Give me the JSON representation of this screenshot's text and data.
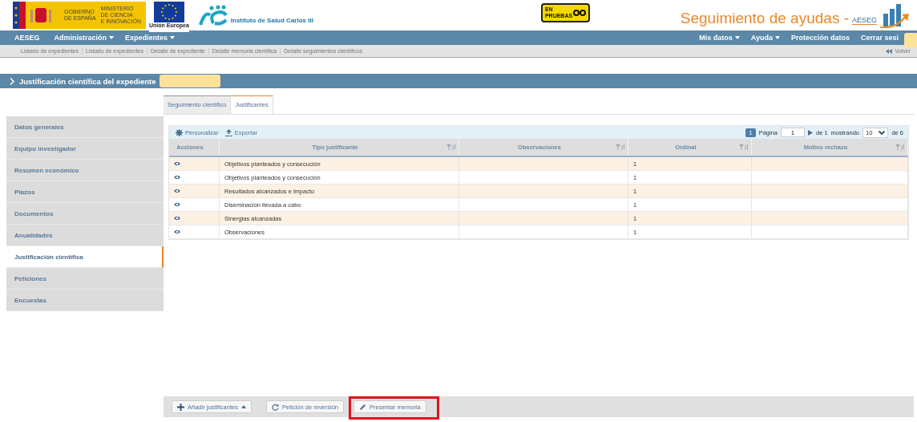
{
  "header": {
    "gov_logo": {
      "line1": "GOBIERNO",
      "line2": "DE ESPAÑA",
      "ministry": [
        "MINISTERIO",
        "DE CIENCIA",
        "E INNOVACIÓN"
      ]
    },
    "eu_logo": {
      "label": "Unión Europea"
    },
    "institute": {
      "name": "Instituto de Salud Carlos III"
    },
    "test_badge": {
      "line1": "EN",
      "line2": "PRUEBAS"
    },
    "app_title": "Seguimiento de ayudas -",
    "app_logo": "AESEG"
  },
  "navbar": {
    "brand": "AESEG",
    "left": [
      {
        "label": "Administración",
        "dropdown": true
      },
      {
        "label": "Expedientes",
        "dropdown": true
      }
    ],
    "right": [
      {
        "label": "Mis datos",
        "dropdown": true
      },
      {
        "label": "Ayuda",
        "dropdown": true
      },
      {
        "label": "Protección datos",
        "dropdown": false
      },
      {
        "label": "Cerrar sesi",
        "dropdown": false,
        "redacted": true
      }
    ]
  },
  "breadcrumb": {
    "items": [
      "Listado de expedientes",
      "Listado de expedientes",
      "Detalle de expediente",
      "Detalle memoria científica",
      "Detalle seguimientos científicos"
    ],
    "back": "Volver"
  },
  "section_title": {
    "text": "Justificación científica del expediente",
    "redacted": true
  },
  "sidebar": {
    "items": [
      {
        "label": "Datos generales",
        "selected": false
      },
      {
        "label": "Equipo investigador",
        "selected": false
      },
      {
        "label": "Resumen económico",
        "selected": false
      },
      {
        "label": "Plazos",
        "selected": false
      },
      {
        "label": "Documentos",
        "selected": false
      },
      {
        "label": "Anualidades",
        "selected": false
      },
      {
        "label": "Justificación científica",
        "selected": true
      },
      {
        "label": "Peticiones",
        "selected": false
      },
      {
        "label": "Encuestas",
        "selected": false
      }
    ]
  },
  "tabs": [
    {
      "label": "Seguimiento científico",
      "selected": false
    },
    {
      "label": "Justificantes",
      "selected": true
    }
  ],
  "grid": {
    "toolbar": [
      "Personalizar",
      "Exportar"
    ],
    "pager": {
      "current_page": "1",
      "page_label": "Página",
      "page_value": "1",
      "of_pages": "de 1",
      "showing_label": "mostrando",
      "page_size": "10",
      "total": "de 6"
    },
    "columns": [
      {
        "label": "Acciones",
        "filterable": false
      },
      {
        "label": "Tipo justificante",
        "filterable": true
      },
      {
        "label": "Observaciones",
        "filterable": true
      },
      {
        "label": "Ordinal",
        "filterable": true
      },
      {
        "label": "Motivo rechazo",
        "filterable": true
      }
    ],
    "rows": [
      {
        "tipo": "Objetivos planteados y consecución",
        "ordinal": "1"
      },
      {
        "tipo": "Objetivos planteados y consecución",
        "ordinal": "1"
      },
      {
        "tipo": "Resultados alcanzados e impacto",
        "ordinal": "1"
      },
      {
        "tipo": "Diseminación llevada a cabo",
        "ordinal": "1"
      },
      {
        "tipo": "Sinergias alcanzadas",
        "ordinal": "1"
      },
      {
        "tipo": "Observaciones",
        "ordinal": "1"
      }
    ]
  },
  "actions": [
    {
      "label": "Añadir justificantes",
      "kind": "add",
      "dropdown": true,
      "highlighted": false
    },
    {
      "label": "Petición de reversión",
      "kind": "refresh",
      "dropdown": false,
      "highlighted": false
    },
    {
      "label": "Presentar memoria",
      "kind": "edit",
      "dropdown": false,
      "highlighted": true
    }
  ]
}
